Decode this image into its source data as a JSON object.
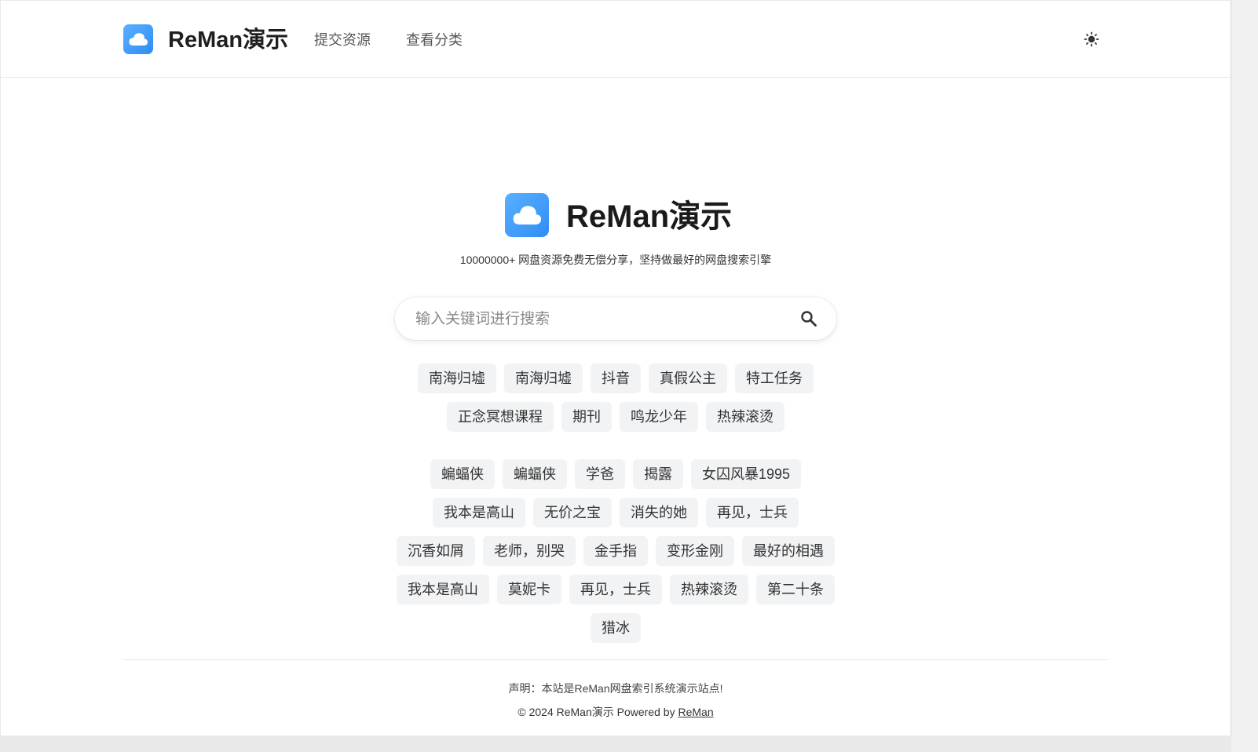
{
  "header": {
    "site_name": "ReMan演示",
    "nav": [
      "提交资源",
      "查看分类"
    ]
  },
  "hero": {
    "title": "ReMan演示",
    "tagline": "10000000+ 网盘资源免费无偿分享，坚持做最好的网盘搜索引擎"
  },
  "search": {
    "placeholder": "输入关键词进行搜索",
    "value": ""
  },
  "hot_tags": [
    [
      "南海归墟",
      "南海归墟",
      "抖音",
      "真假公主",
      "特工任务"
    ],
    [
      "正念冥想课程",
      "期刊",
      "鸣龙少年",
      "热辣滚烫"
    ]
  ],
  "recent_tags": [
    [
      "蝙蝠侠",
      "蝙蝠侠",
      "学爸",
      "揭露",
      "女囚风暴1995"
    ],
    [
      "我本是高山",
      "无价之宝",
      "消失的她",
      "再见，士兵"
    ],
    [
      "沉香如屑",
      "老师，别哭",
      "金手指",
      "变形金刚",
      "最好的相遇"
    ],
    [
      "我本是高山",
      "莫妮卡",
      "再见，士兵",
      "热辣滚烫",
      "第二十条"
    ],
    [
      "猎冰"
    ]
  ],
  "footer": {
    "disclaimer": "声明：本站是ReMan网盘索引系统演示站点!",
    "copyright": "© 2024 ReMan演示  Powered by",
    "powered_link": "ReMan"
  },
  "colors": {
    "brand": "#2f8df5",
    "tag_bg": "#f2f3f5"
  },
  "icons": [
    "cloud-logo-icon",
    "sun-icon",
    "search-icon"
  ]
}
